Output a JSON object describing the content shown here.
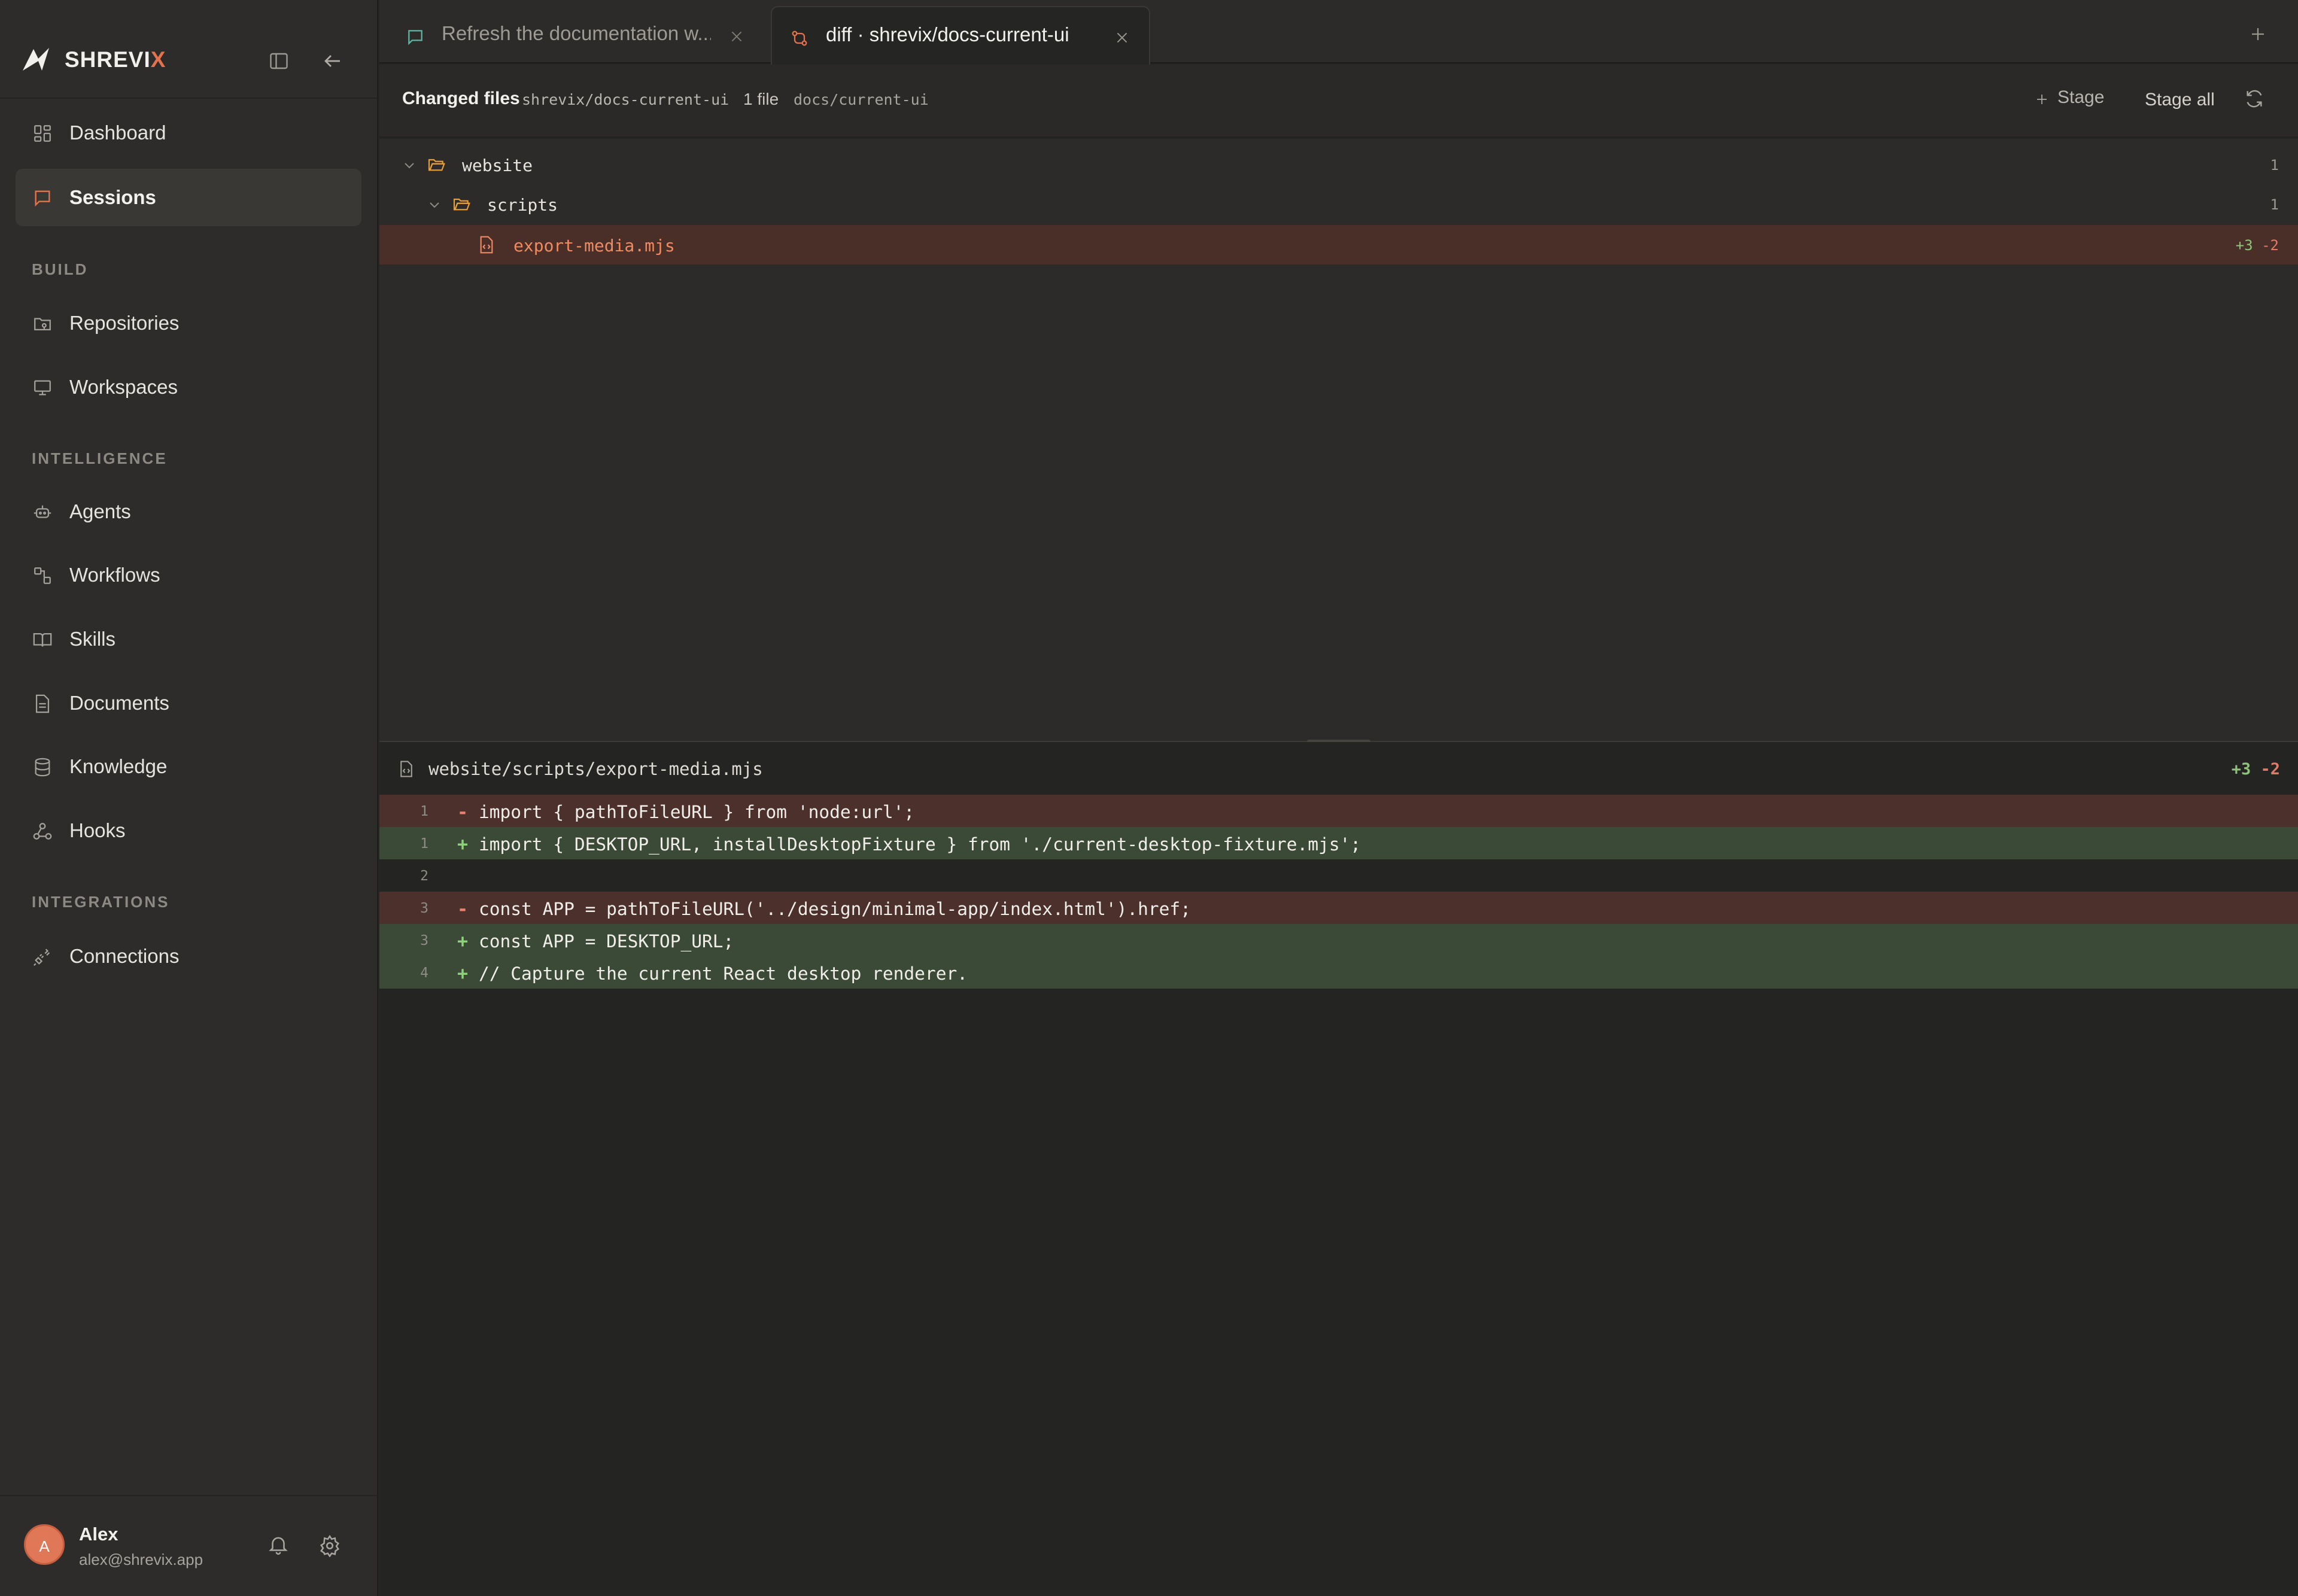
{
  "brand": {
    "name_main": "SHREVI",
    "name_accent": "X",
    "accent_color": "#e4734d"
  },
  "sidebar": {
    "nav_top": [
      {
        "label": "Dashboard",
        "icon": "dashboard-icon"
      },
      {
        "label": "Sessions",
        "icon": "chat-bubble-icon",
        "active": true
      }
    ],
    "sections": [
      {
        "title": "BUILD",
        "items": [
          {
            "label": "Repositories",
            "icon": "repository-icon"
          },
          {
            "label": "Workspaces",
            "icon": "monitor-icon"
          }
        ]
      },
      {
        "title": "INTELLIGENCE",
        "items": [
          {
            "label": "Agents",
            "icon": "robot-icon"
          },
          {
            "label": "Workflows",
            "icon": "workflow-icon"
          },
          {
            "label": "Skills",
            "icon": "book-icon"
          },
          {
            "label": "Documents",
            "icon": "document-icon"
          },
          {
            "label": "Knowledge",
            "icon": "database-icon"
          },
          {
            "label": "Hooks",
            "icon": "webhook-icon"
          }
        ]
      },
      {
        "title": "INTEGRATIONS",
        "items": [
          {
            "label": "Connections",
            "icon": "plug-icon"
          }
        ]
      }
    ],
    "user": {
      "initial": "A",
      "name": "Alex",
      "email": "alex@shrevix.app"
    }
  },
  "tabs": [
    {
      "title": "Refresh the documentation w...",
      "icon": "chat-bubble-icon",
      "active": false
    },
    {
      "title": "diff · shrevix/docs-current-ui",
      "icon": "git-compare-icon",
      "active": true
    }
  ],
  "toolbar": {
    "title": "Changed files",
    "branch": "shrevix/docs-current-ui",
    "file_count": "1 file",
    "path": "docs/current-ui",
    "stage_label": "Stage",
    "stage_all_label": "Stage all"
  },
  "tree": [
    {
      "name": "website",
      "type": "folder",
      "count": "1"
    },
    {
      "name": "scripts",
      "type": "folder",
      "count": "1"
    },
    {
      "name": "export-media.mjs",
      "type": "file",
      "added": "+3",
      "removed": "-2"
    }
  ],
  "diff": {
    "file": "website/scripts/export-media.mjs",
    "added": "+3",
    "removed": "-2",
    "lines": [
      {
        "num": "1",
        "kind": "del",
        "marker": "-",
        "code": "import { pathToFileURL } from 'node:url';"
      },
      {
        "num": "1",
        "kind": "add",
        "marker": "+",
        "code": "import { DESKTOP_URL, installDesktopFixture } from './current-desktop-fixture.mjs';"
      },
      {
        "num": "2",
        "kind": "ctx",
        "marker": "",
        "code": ""
      },
      {
        "num": "3",
        "kind": "del",
        "marker": "-",
        "code": "const APP = pathToFileURL('../design/minimal-app/index.html').href;"
      },
      {
        "num": "3",
        "kind": "add",
        "marker": "+",
        "code": "const APP = DESKTOP_URL;"
      },
      {
        "num": "4",
        "kind": "add",
        "marker": "+",
        "code": "// Capture the current React desktop renderer."
      }
    ]
  },
  "colors": {
    "added": "#8fc37c",
    "removed": "#e27a6a",
    "file_highlight": "#f08a63"
  }
}
